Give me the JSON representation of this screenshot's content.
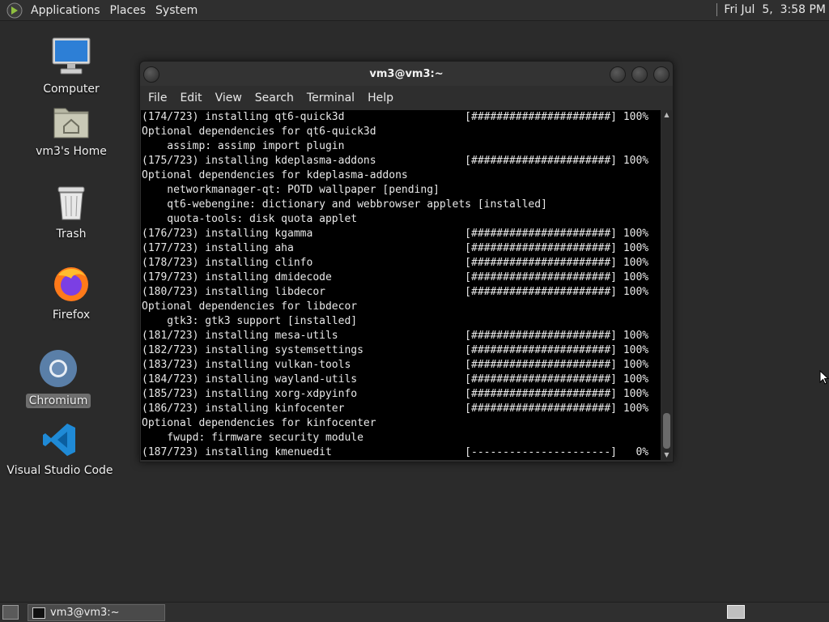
{
  "top_panel": {
    "menus": [
      "Applications",
      "Places",
      "System"
    ],
    "clock": "Fri Jul  5,  3:58 PM"
  },
  "desktop": {
    "icons": [
      {
        "label": "Computer",
        "icon": "computer-icon"
      },
      {
        "label": "vm3's Home",
        "icon": "home-folder-icon"
      },
      {
        "label": "Trash",
        "icon": "trash-icon"
      },
      {
        "label": "Firefox",
        "icon": "firefox-icon"
      },
      {
        "label": "Chromium",
        "icon": "chromium-icon",
        "selected": true
      },
      {
        "label": "Visual Studio Code",
        "icon": "vscode-icon"
      }
    ]
  },
  "terminal": {
    "title": "vm3@vm3:~",
    "menus": [
      "File",
      "Edit",
      "View",
      "Search",
      "Terminal",
      "Help"
    ],
    "lines": [
      "(174/723) installing qt6-quick3d                   [######################] 100%",
      "Optional dependencies for qt6-quick3d",
      "    assimp: assimp import plugin",
      "(175/723) installing kdeplasma-addons              [######################] 100%",
      "Optional dependencies for kdeplasma-addons",
      "    networkmanager-qt: POTD wallpaper [pending]",
      "    qt6-webengine: dictionary and webbrowser applets [installed]",
      "    quota-tools: disk quota applet",
      "(176/723) installing kgamma                        [######################] 100%",
      "(177/723) installing aha                           [######################] 100%",
      "(178/723) installing clinfo                        [######################] 100%",
      "(179/723) installing dmidecode                     [######################] 100%",
      "(180/723) installing libdecor                      [######################] 100%",
      "Optional dependencies for libdecor",
      "    gtk3: gtk3 support [installed]",
      "(181/723) installing mesa-utils                    [######################] 100%",
      "(182/723) installing systemsettings                [######################] 100%",
      "(183/723) installing vulkan-tools                  [######################] 100%",
      "(184/723) installing wayland-utils                 [######################] 100%",
      "(185/723) installing xorg-xdpyinfo                 [######################] 100%",
      "(186/723) installing kinfocenter                   [######################] 100%",
      "Optional dependencies for kinfocenter",
      "    fwupd: firmware security module",
      "(187/723) installing kmenuedit                     [----------------------]   0%"
    ]
  },
  "taskbar": {
    "window_button": "vm3@vm3:~"
  }
}
